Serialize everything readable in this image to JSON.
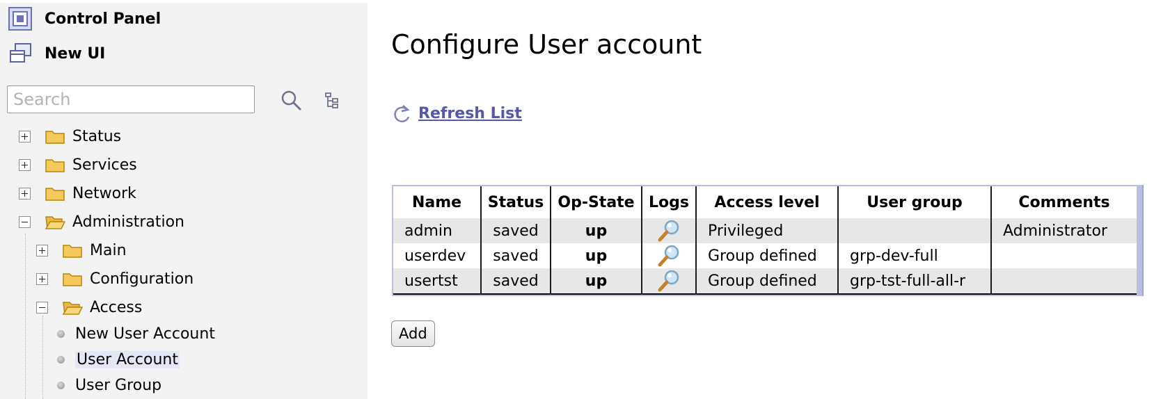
{
  "sidebar": {
    "control_panel": "Control Panel",
    "new_ui": "New UI",
    "search_placeholder": "Search",
    "tree": {
      "status": "Status",
      "services": "Services",
      "network": "Network",
      "administration": "Administration",
      "main": "Main",
      "configuration": "Configuration",
      "access": "Access",
      "leaves": [
        "New User Account",
        "User Account",
        "User Group"
      ]
    }
  },
  "main": {
    "title": "Configure User account",
    "refresh": "Refresh List",
    "table": {
      "headers": [
        "Name",
        "Status",
        "Op-State",
        "Logs",
        "Access level",
        "User group",
        "Comments"
      ],
      "rows": [
        {
          "name": "admin",
          "status": "saved",
          "op_state": "up",
          "access_level": "Privileged",
          "user_group": "",
          "comments": "Administrator"
        },
        {
          "name": "userdev",
          "status": "saved",
          "op_state": "up",
          "access_level": "Group defined",
          "user_group": "grp-dev-full",
          "comments": ""
        },
        {
          "name": "usertst",
          "status": "saved",
          "op_state": "up",
          "access_level": "Group defined",
          "user_group": "grp-tst-full-all-r",
          "comments": ""
        }
      ]
    },
    "add": "Add"
  },
  "colors": {
    "sidebar_bg": "#f3f3f3",
    "link": "#5358a8",
    "table_frame": "#b9bfe0",
    "row_stripe": "#e7e7e7",
    "folder": "#f5c95b"
  },
  "icons": [
    "control-panel-icon",
    "new-ui-icon",
    "search-icon",
    "tree-view-icon",
    "folder-icon",
    "folder-open-icon",
    "refresh-icon",
    "magnifier-icon"
  ]
}
